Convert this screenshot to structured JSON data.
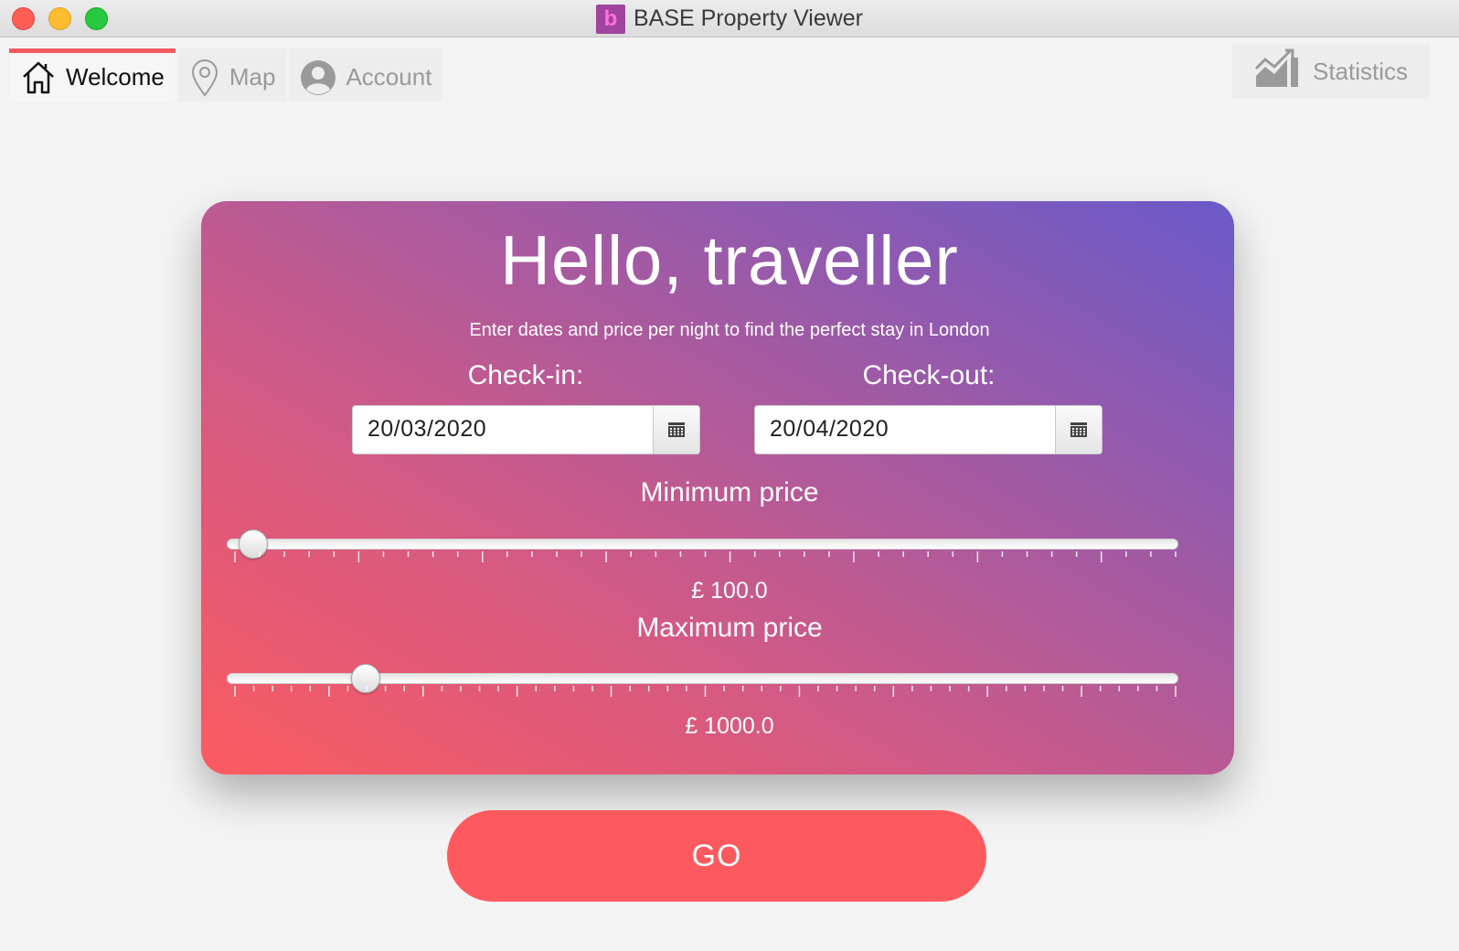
{
  "window": {
    "title": "BASE Property Viewer",
    "logo_letter": "b"
  },
  "tabs": [
    {
      "label": "Welcome",
      "icon": "home-icon",
      "active": true
    },
    {
      "label": "Map",
      "icon": "map-pin-icon",
      "active": false
    },
    {
      "label": "Account",
      "icon": "account-icon",
      "active": false
    }
  ],
  "statistics": {
    "label": "Statistics",
    "icon": "chart-icon"
  },
  "card": {
    "heading": "Hello, traveller",
    "subtitle": "Enter dates and price per night to find the perfect stay in London",
    "checkin": {
      "label": "Check-in:",
      "value": "20/03/2020"
    },
    "checkout": {
      "label": "Check-out:",
      "value": "20/04/2020"
    },
    "min_price": {
      "label": "Minimum price",
      "value_text": "£ 100.0",
      "slider_fraction": 0.02
    },
    "max_price": {
      "label": "Maximum price",
      "value_text": "£ 1000.0",
      "slider_fraction": 0.14
    }
  },
  "go_button": {
    "label": "GO"
  },
  "colors": {
    "accent": "#fd5a5f",
    "gradient_start": "#fb5b60",
    "gradient_end": "#6a5ac9"
  }
}
